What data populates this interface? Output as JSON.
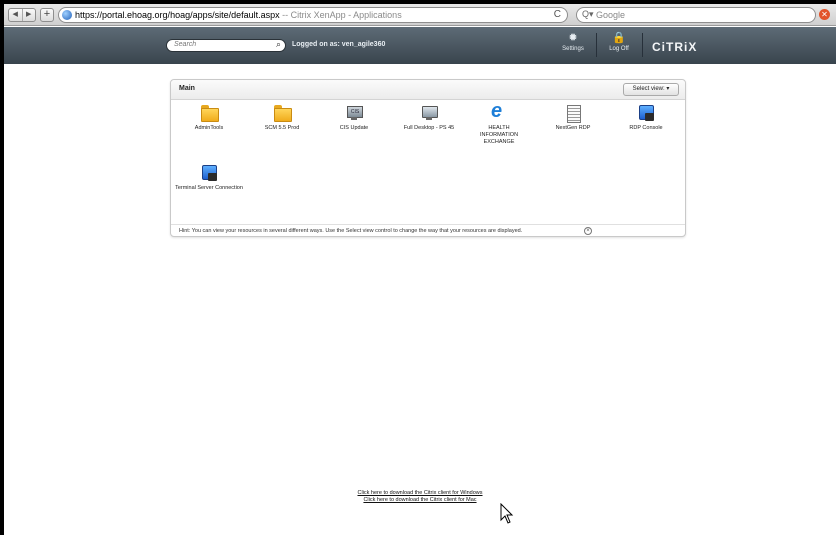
{
  "browser": {
    "url": "https://portal.ehoag.org/hoag/apps/site/default.aspx",
    "page_title": " -- Citrix XenApp - Applications",
    "search_placeholder": "Google",
    "back_glyph": "◀",
    "forward_glyph": "▶",
    "add_glyph": "+",
    "reload_glyph": "C",
    "search_glyph": "Q▾",
    "stop_glyph": "✕"
  },
  "header": {
    "search_placeholder": "Search",
    "search_glyph": "⌕",
    "logged_on": "Logged on as: ven_agile360",
    "settings_label": "Settings",
    "settings_glyph": "✹",
    "logoff_label": "Log Off",
    "logoff_glyph": "🔒",
    "logo": "CiTRiX"
  },
  "panel": {
    "title": "Main",
    "select_view": "Select view: ▾",
    "apps": [
      {
        "label": "AdminTools",
        "icon": "folder-icon"
      },
      {
        "label": "SCM 5.5 Prod",
        "icon": "folder-icon"
      },
      {
        "label": "CIS Update",
        "icon": "cis-icon"
      },
      {
        "label": "Full Desktop - PS 45",
        "icon": "monitor-icon"
      },
      {
        "label": "HEALTH INFORMATION EXCHANGE",
        "icon": "ie-icon"
      },
      {
        "label": "NextGen RDP",
        "icon": "doc-icon"
      },
      {
        "label": "RDP Console",
        "icon": "blue-icon"
      },
      {
        "label": "Terminal Server Connection",
        "icon": "blue-icon"
      }
    ],
    "hint": "Hint: You can view your resources in several different ways. Use the Select view control to change the way that your resources are displayed.",
    "hint_close_glyph": "×"
  },
  "downloads": {
    "windows": "Click here to download the Citrix client for Windows",
    "mac": "Click here to download the Citrix client for Mac"
  }
}
